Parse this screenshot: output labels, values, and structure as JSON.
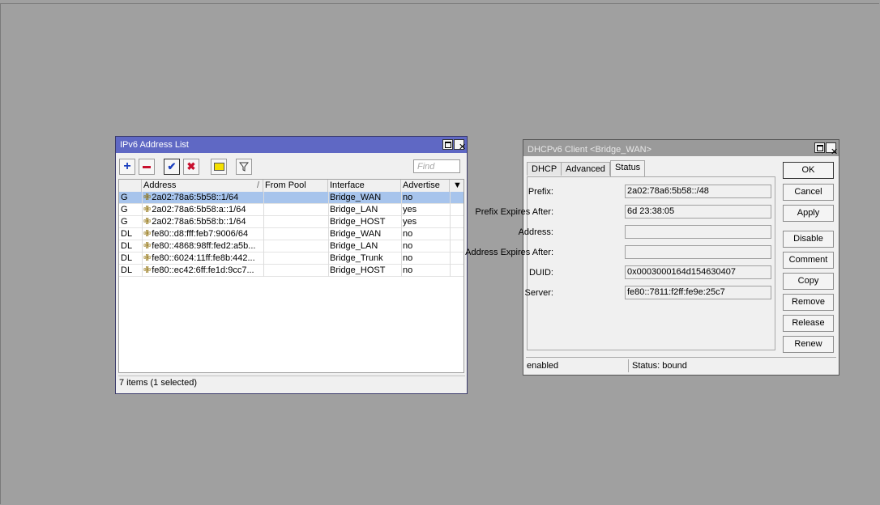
{
  "addr_window": {
    "title": "IPv6 Address List",
    "find_placeholder": "Find",
    "columns": [
      "Address",
      "From Pool",
      "Interface",
      "Advertise"
    ],
    "sort_indicator": "/",
    "rows": [
      {
        "flag": "G",
        "address": "2a02:78a6:5b58::1/64",
        "pool": "",
        "interface": "Bridge_WAN",
        "advertise": "no",
        "selected": true
      },
      {
        "flag": "G",
        "address": "2a02:78a6:5b58:a::1/64",
        "pool": "",
        "interface": "Bridge_LAN",
        "advertise": "yes",
        "selected": false
      },
      {
        "flag": "G",
        "address": "2a02:78a6:5b58:b::1/64",
        "pool": "",
        "interface": "Bridge_HOST",
        "advertise": "yes",
        "selected": false
      },
      {
        "flag": "DL",
        "address": "fe80::d8:fff:feb7:9006/64",
        "pool": "",
        "interface": "Bridge_WAN",
        "advertise": "no",
        "selected": false
      },
      {
        "flag": "DL",
        "address": "fe80::4868:98ff:fed2:a5b...",
        "pool": "",
        "interface": "Bridge_LAN",
        "advertise": "no",
        "selected": false
      },
      {
        "flag": "DL",
        "address": "fe80::6024:11ff:fe8b:442...",
        "pool": "",
        "interface": "Bridge_Trunk",
        "advertise": "no",
        "selected": false
      },
      {
        "flag": "DL",
        "address": "fe80::ec42:6ff:fe1d:9cc7...",
        "pool": "",
        "interface": "Bridge_HOST",
        "advertise": "no",
        "selected": false
      }
    ],
    "status": "7 items (1 selected)",
    "toolbar_icons": [
      "add-icon",
      "remove-icon",
      "enable-icon",
      "disable-icon",
      "comment-icon",
      "filter-icon"
    ]
  },
  "dhcp_window": {
    "title": "DHCPv6 Client <Bridge_WAN>",
    "tabs": [
      "DHCP",
      "Advanced",
      "Status"
    ],
    "fields": [
      {
        "label": "Prefix:",
        "value": "2a02:78a6:5b58::/48"
      },
      {
        "label": "Prefix Expires After:",
        "value": "6d 23:38:05"
      },
      {
        "label": "Address:",
        "value": ""
      },
      {
        "label": "Address Expires After:",
        "value": ""
      },
      {
        "label": "DUID:",
        "value": "0x0003000164d154630407"
      },
      {
        "label": "Server:",
        "value": "fe80::7811:f2ff:fe9e:25c7"
      }
    ],
    "buttons": [
      "OK",
      "Cancel",
      "Apply",
      "Disable",
      "Comment",
      "Copy",
      "Remove",
      "Release",
      "Renew"
    ],
    "status_left": "enabled",
    "status_right": "Status: bound"
  }
}
